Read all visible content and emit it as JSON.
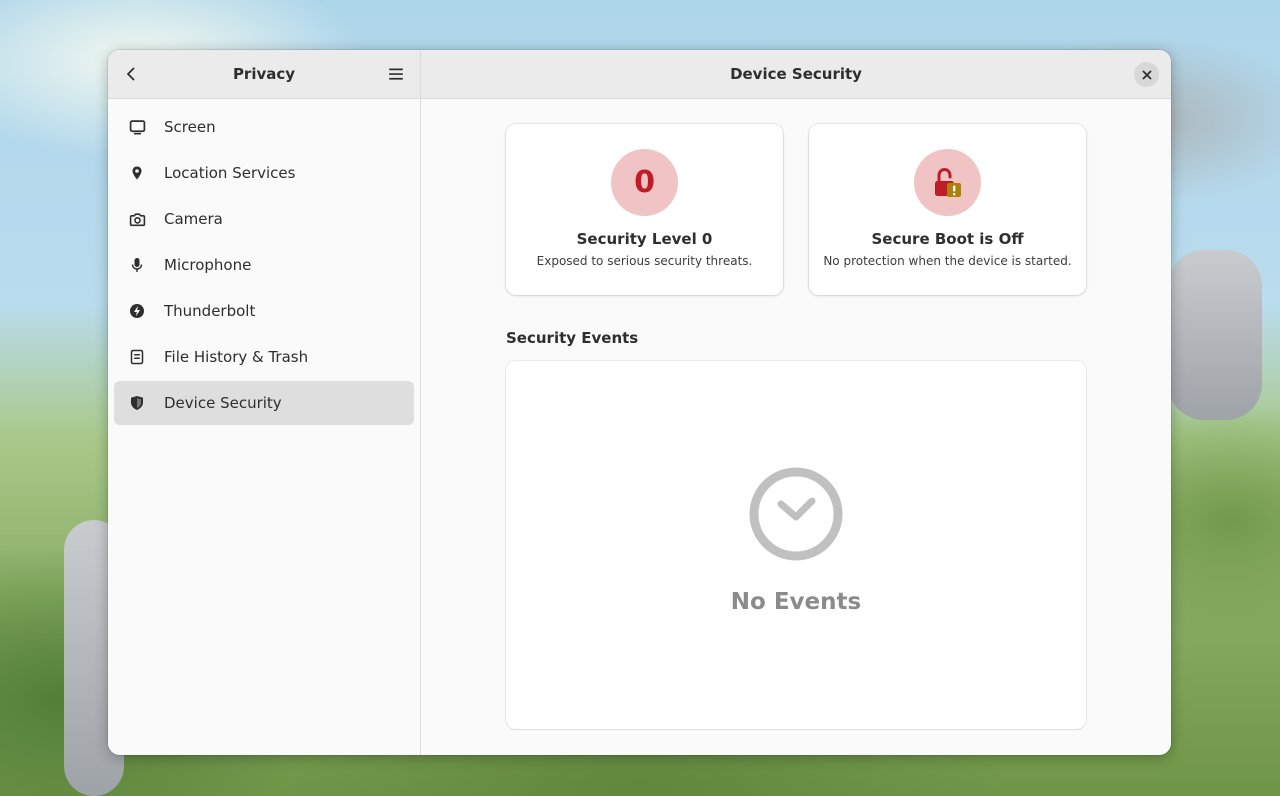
{
  "sidebar": {
    "title": "Privacy",
    "items": [
      {
        "label": "Screen",
        "icon": "display-icon"
      },
      {
        "label": "Location Services",
        "icon": "location-pin-icon"
      },
      {
        "label": "Camera",
        "icon": "camera-icon"
      },
      {
        "label": "Microphone",
        "icon": "microphone-icon"
      },
      {
        "label": "Thunderbolt",
        "icon": "thunderbolt-icon"
      },
      {
        "label": "File History & Trash",
        "icon": "file-history-icon"
      },
      {
        "label": "Device Security",
        "icon": "shield-icon",
        "selected": true
      }
    ]
  },
  "main": {
    "title": "Device Security",
    "cards": [
      {
        "badge": "0",
        "title": "Security Level 0",
        "subtitle": "Exposed to serious security threats."
      },
      {
        "badge_icon": "unlocked-padlock-warning-icon",
        "title": "Secure Boot is Off",
        "subtitle": "No protection when the device is started."
      }
    ],
    "events_section": {
      "title": "Security Events",
      "empty_label": "No Events",
      "empty_icon": "clock-check-icon"
    }
  },
  "colors": {
    "danger_red": "#c01c28",
    "badge_bg": "#f0c4c4",
    "warning_amber": "#b0800f",
    "selected_row": "#dedede",
    "header_bg": "#ebebeb"
  }
}
